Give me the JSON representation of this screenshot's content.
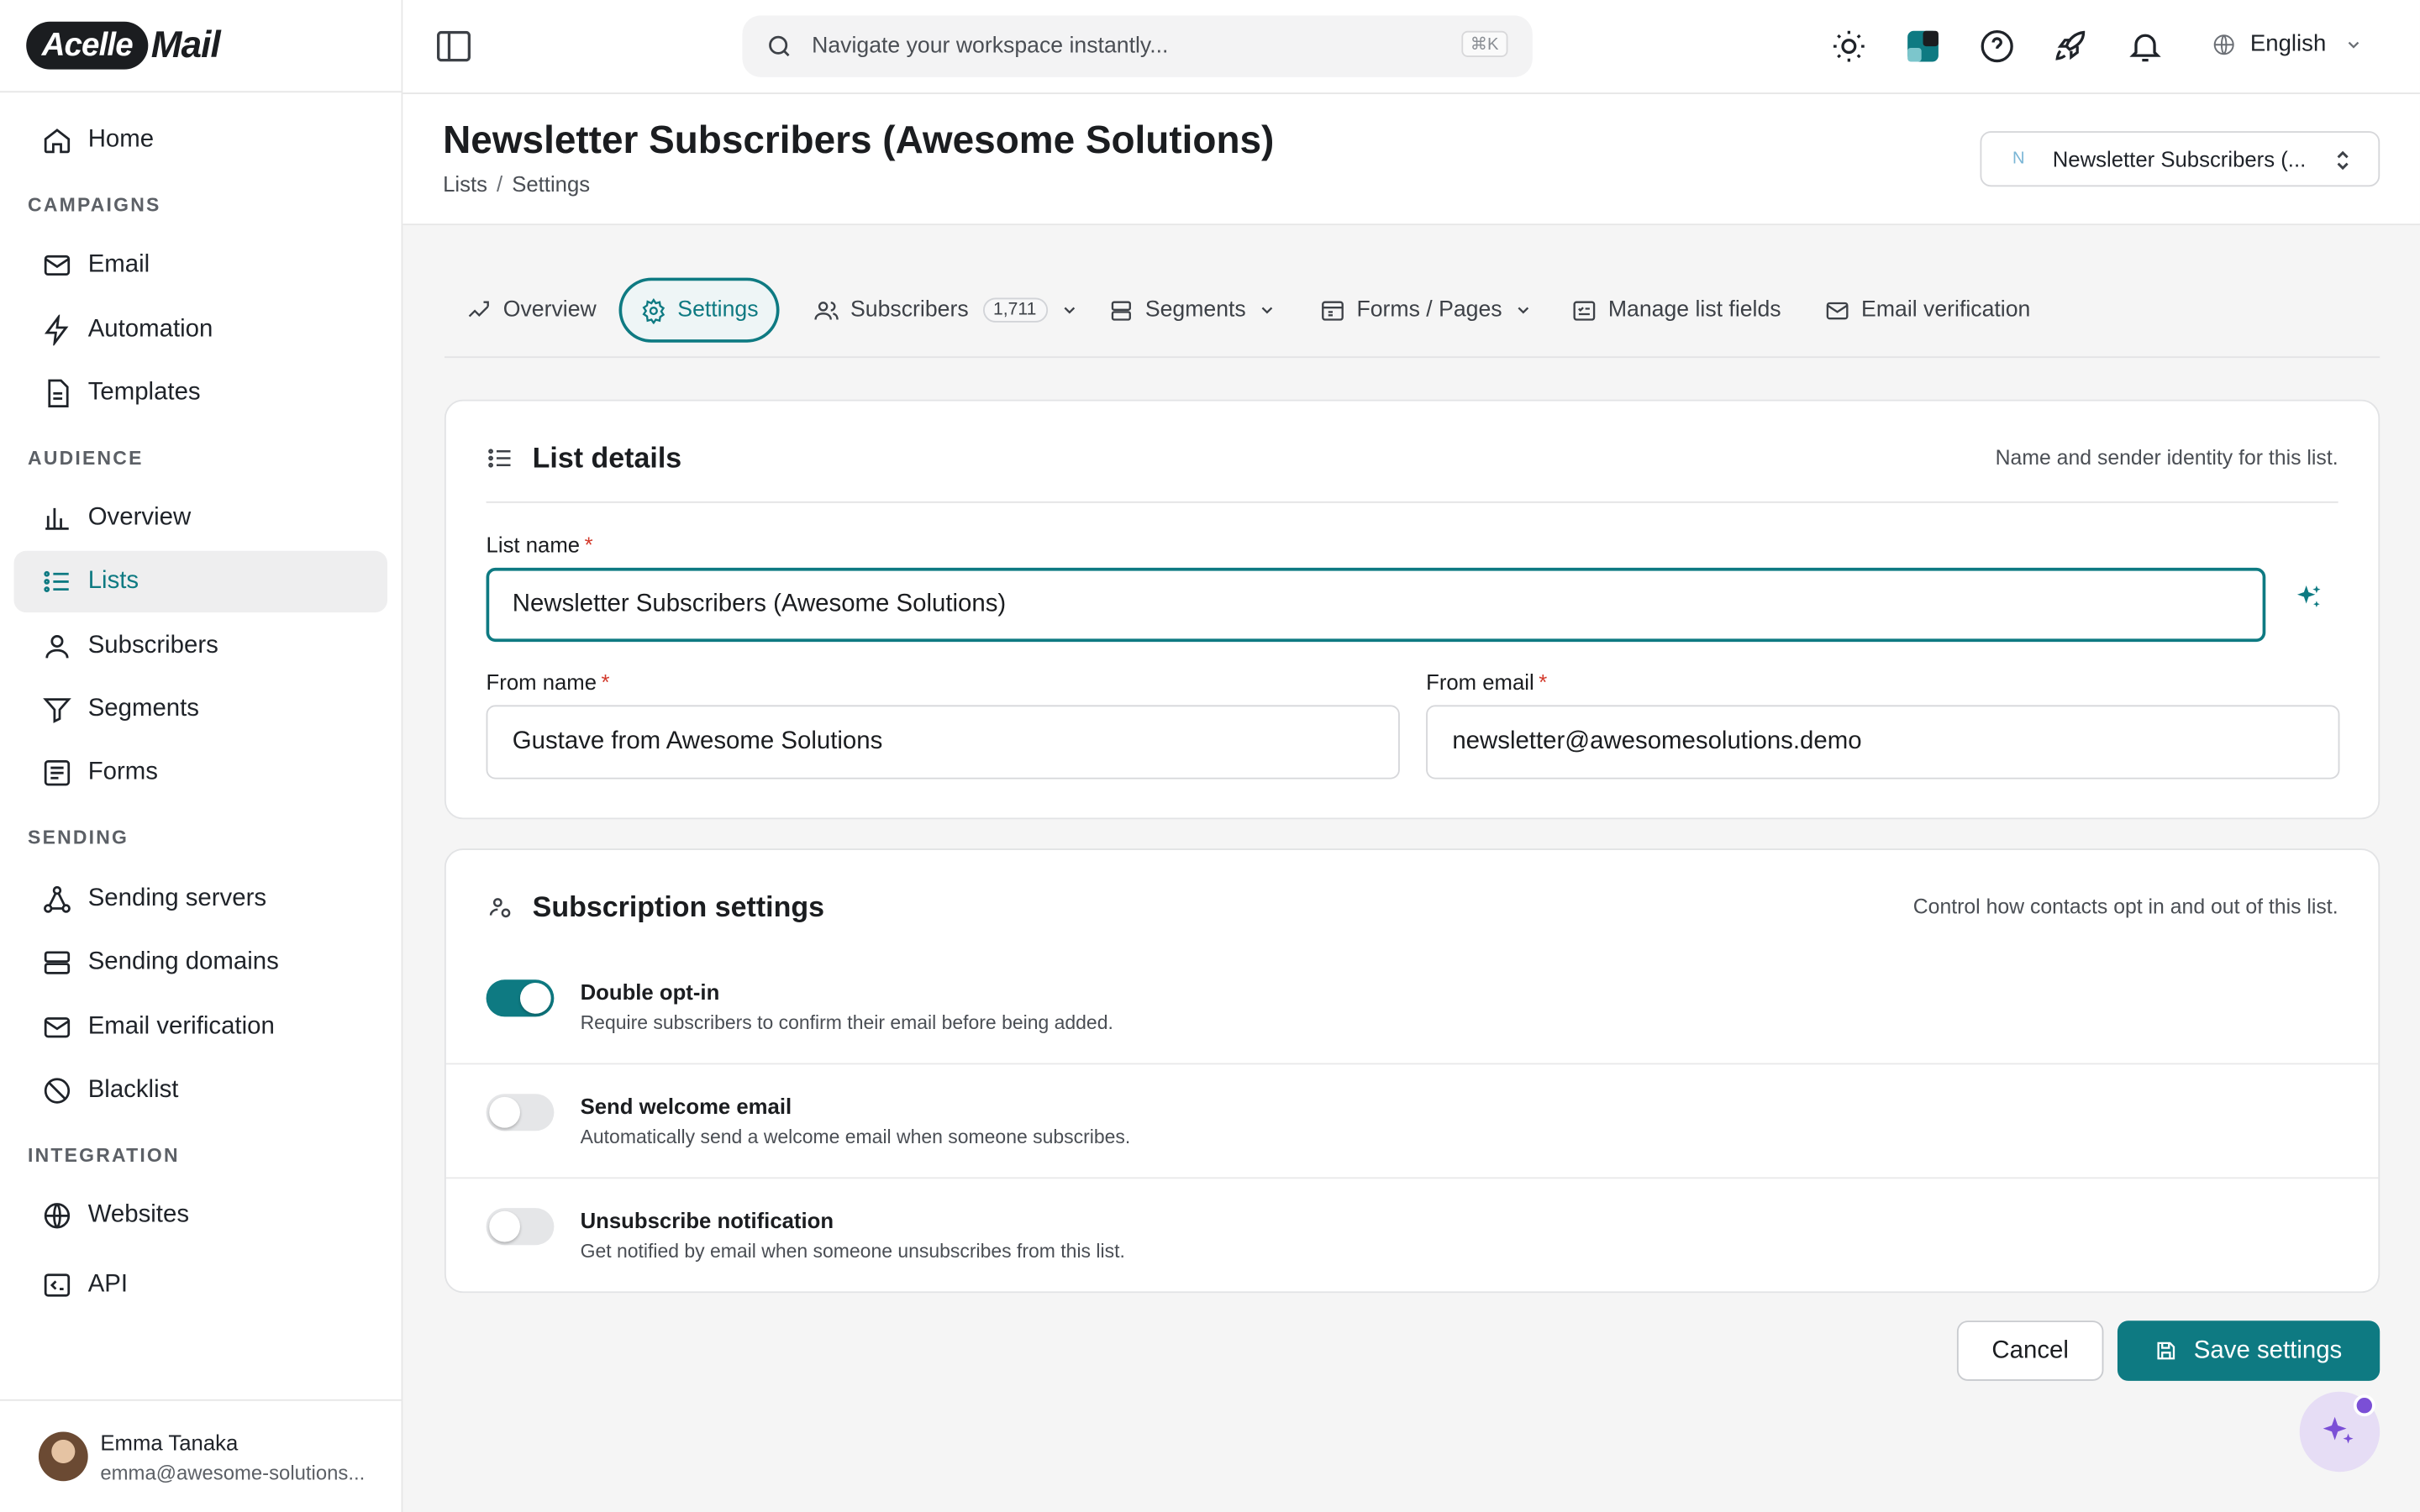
{
  "brand": {
    "logo_left": "Acelle",
    "logo_right": "Mail"
  },
  "sidebar": {
    "home": "Home",
    "sections": {
      "campaigns": "CAMPAIGNS",
      "audience": "AUDIENCE",
      "sending": "SENDING",
      "integration": "INTEGRATION"
    },
    "items": {
      "email": "Email",
      "automation": "Automation",
      "templates": "Templates",
      "overview": "Overview",
      "lists": "Lists",
      "subscribers": "Subscribers",
      "segments": "Segments",
      "forms": "Forms",
      "sending_servers": "Sending servers",
      "sending_domains": "Sending domains",
      "email_verification": "Email verification",
      "blacklist": "Blacklist",
      "websites": "Websites",
      "api": "API"
    },
    "active": "lists",
    "user": {
      "name": "Emma Tanaka",
      "email": "emma@awesome-solutions..."
    }
  },
  "topbar": {
    "search_placeholder": "Navigate your workspace instantly...",
    "search_shortcut": "⌘K",
    "language": "English"
  },
  "page": {
    "title": "Newsletter Subscribers (Awesome Solutions)",
    "breadcrumb": [
      "Lists",
      "Settings"
    ],
    "list_switcher": {
      "initial": "N",
      "label": "Newsletter Subscribers (..."
    }
  },
  "tabs": {
    "overview": "Overview",
    "settings": "Settings",
    "subscribers": "Subscribers",
    "subscribers_count": "1,711",
    "segments": "Segments",
    "forms_pages": "Forms / Pages",
    "manage_fields": "Manage list fields",
    "email_verification": "Email verification",
    "active": "settings"
  },
  "list_details": {
    "title": "List details",
    "description": "Name and sender identity for this list.",
    "list_name_label": "List name",
    "list_name_value": "Newsletter Subscribers (Awesome Solutions)",
    "from_name_label": "From name",
    "from_name_value": "Gustave from Awesome Solutions",
    "from_email_label": "From email",
    "from_email_value": "newsletter@awesomesolutions.demo",
    "required_mark": "*"
  },
  "subscription": {
    "title": "Subscription settings",
    "description": "Control how contacts opt in and out of this list.",
    "options": [
      {
        "title": "Double opt-in",
        "desc": "Require subscribers to confirm their email before being added.",
        "enabled": true
      },
      {
        "title": "Send welcome email",
        "desc": "Automatically send a welcome email when someone subscribes.",
        "enabled": false
      },
      {
        "title": "Unsubscribe notification",
        "desc": "Get notified by email when someone unsubscribes from this list.",
        "enabled": false
      }
    ]
  },
  "actions": {
    "cancel": "Cancel",
    "save": "Save settings"
  },
  "colors": {
    "accent": "#0e7a82",
    "required": "#d33a2c",
    "ai": "#7b4fd6"
  }
}
